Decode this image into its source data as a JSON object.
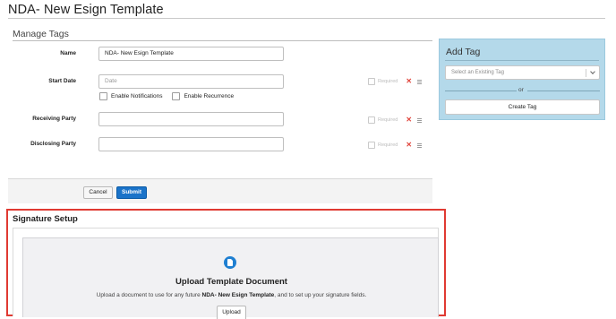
{
  "page": {
    "title": "NDA- New Esign Template"
  },
  "manage_tags": {
    "title": "Manage Tags",
    "fields": [
      {
        "label": "Name",
        "value": "NDA- New Esign Template",
        "placeholder": ""
      },
      {
        "label": "Start Date",
        "value": "",
        "placeholder": "Date"
      },
      {
        "label": "Receiving Party",
        "value": "",
        "placeholder": ""
      },
      {
        "label": "Disclosing Party",
        "value": "",
        "placeholder": ""
      }
    ],
    "required_label": "Required",
    "options": {
      "enable_notifications": "Enable Notifications",
      "enable_recurrence": "Enable Recurrence"
    },
    "cancel_label": "Cancel",
    "submit_label": "Submit"
  },
  "add_tag": {
    "title": "Add Tag",
    "select_placeholder": "Select an Existing Tag",
    "or_label": "or",
    "create_label": "Create Tag"
  },
  "signature_setup": {
    "title": "Signature Setup",
    "upload_title": "Upload Template Document",
    "desc_prefix": "Upload a document to use for any future ",
    "desc_template": "NDA- New Esign Template",
    "desc_suffix": ", and to set up your signature fields.",
    "upload_label": "Upload"
  },
  "colors": {
    "accent": "#1a73c9",
    "add_tag_panel": "#b4d9ea",
    "highlight_border": "#e03a32",
    "remove_icon": "#e0443b"
  },
  "icons": [
    "close-icon",
    "list-icon",
    "chevron-down-icon",
    "document-icon"
  ]
}
